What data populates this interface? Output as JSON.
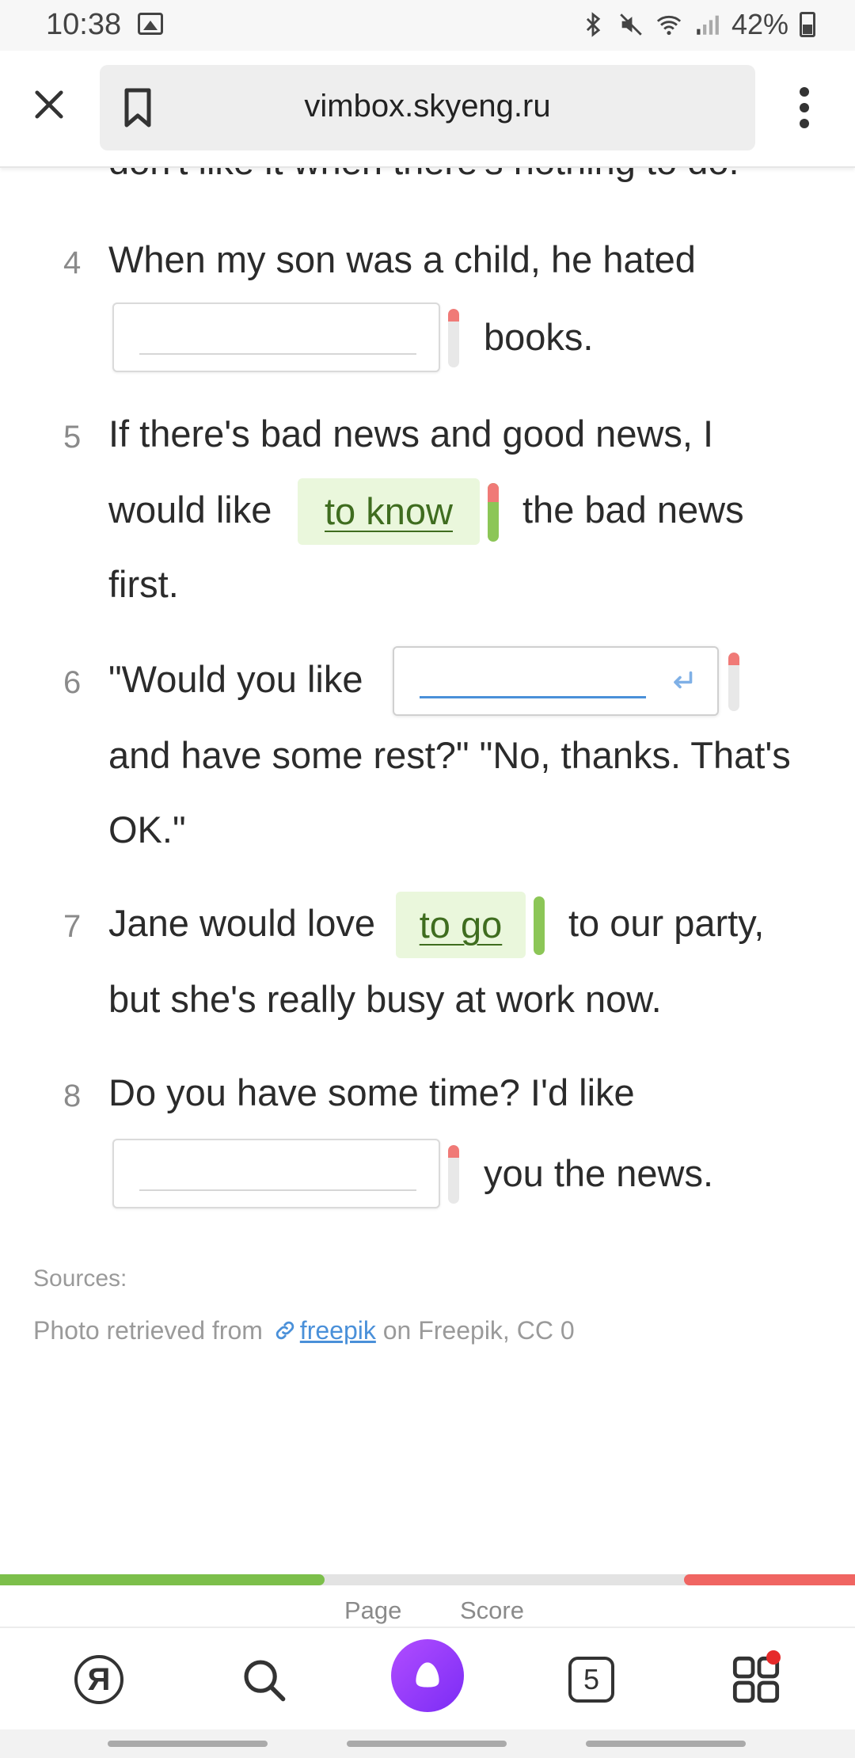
{
  "status_bar": {
    "time": "10:38",
    "battery": "42%",
    "icons": [
      "gallery-icon",
      "bluetooth-icon",
      "mute-icon",
      "wifi-icon",
      "signal-icon",
      "battery-icon"
    ]
  },
  "browser": {
    "url": "vimbox.skyeng.ru",
    "icons": [
      "close-icon",
      "bookmark-icon",
      "more-vert-icon"
    ]
  },
  "exercise": {
    "partial_line": "don't like it when there's nothing to do.",
    "items": [
      {
        "number": "4",
        "line1": "When my son was a child, he hated",
        "after_gap": "books.",
        "answer": "",
        "status": "empty"
      },
      {
        "number": "5",
        "line1_before": "If there's bad news and good news, I",
        "before_gap": "would like",
        "answer": "to know",
        "after_gap": "the bad news",
        "line3": "first.",
        "status": "correct-after-error"
      },
      {
        "number": "6",
        "before_gap": "\"Would you like",
        "answer": "",
        "line2": "and have some rest?\" \"No, thanks. That's",
        "line3": "OK.\"",
        "status": "active"
      },
      {
        "number": "7",
        "before_gap": "Jane would love",
        "answer": "to go",
        "after_gap": "to our party,",
        "line2": "but she's really busy at work now.",
        "status": "correct"
      },
      {
        "number": "8",
        "line1": "Do you have some time? I'd like",
        "after_gap": "you the news.",
        "answer": "",
        "status": "empty"
      }
    ],
    "colors": {
      "correct_bg": "#eaf7dc",
      "correct_text": "#3f6d1f",
      "error": "#f07a77",
      "ok": "#8cc657",
      "active_line": "#4a90d9"
    }
  },
  "sources": {
    "label": "Sources:",
    "prefix": "Photo retrieved from",
    "link": "freepik",
    "suffix": "on Freepik, CC 0"
  },
  "progress": {
    "page_label": "Page",
    "score_label": "Score",
    "correct_fraction": 0.38,
    "wrong_fraction": 0.2,
    "colors": {
      "correct": "#7cbf4b",
      "wrong": "#f06562",
      "track": "#e3e3e3"
    }
  },
  "bottom_nav": {
    "yandex_glyph": "Я",
    "tabs_count": "5",
    "icons": [
      "yandex-icon",
      "search-icon",
      "alice-icon",
      "tabs-icon",
      "apps-grid-icon"
    ]
  }
}
